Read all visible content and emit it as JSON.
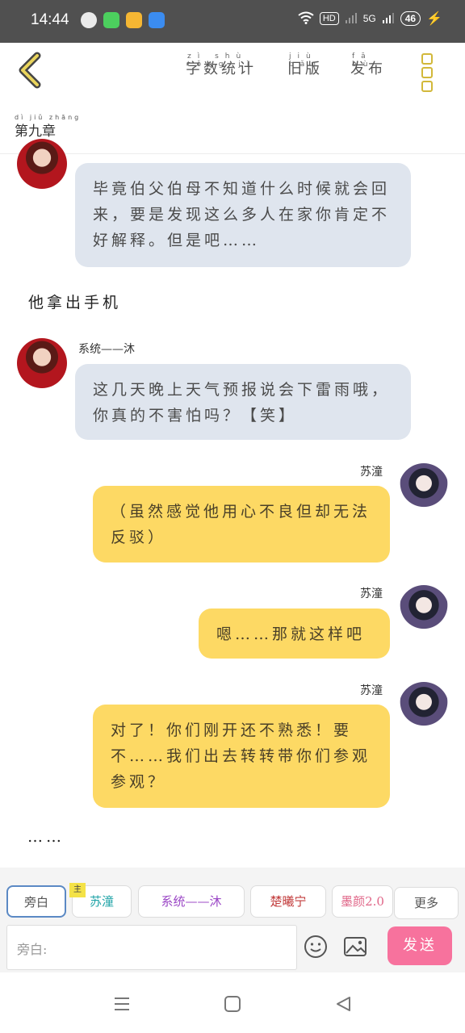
{
  "status_bar": {
    "time": "14:44",
    "hd_label": "HD",
    "network_label": "5G",
    "battery": "46"
  },
  "topbar": {
    "nav": [
      {
        "pinyin": "zì shù tǒng jì",
        "label": "字数统计"
      },
      {
        "pinyin": "jiù bǎn",
        "label": "旧版"
      },
      {
        "pinyin": "fā bù",
        "label": "发布"
      }
    ]
  },
  "chapter": {
    "pinyin": "dì jiǔ zhāng",
    "title": "第九章"
  },
  "messages": {
    "m1": {
      "text": "毕竟伯父伯母不知道什么时候就会回来，要是发现这么多人在家你肯定不好解释。但是吧……"
    },
    "narration1": {
      "text": "他拿出手机"
    },
    "m2": {
      "speaker": "系统——沐",
      "text": "这几天晚上天气预报说会下雷雨哦，你真的不害怕吗？【笑】"
    },
    "m3": {
      "speaker": "苏潼",
      "text": "（虽然感觉他用心不良但却无法反驳）"
    },
    "m4": {
      "speaker": "苏潼",
      "text": "嗯……那就这样吧"
    },
    "m5": {
      "speaker": "苏潼",
      "text": "对了！你们刚开还不熟悉！要不……我们出去转转带你们参观参观？"
    },
    "narration2": {
      "text": "……"
    }
  },
  "role_chips": {
    "narration": "旁白",
    "main_badge": "主",
    "su_tong": "苏潼",
    "system_mu": "系统——沐",
    "chu_xi_ning": "楚曦宁",
    "mo_yan": "墨颜2.0",
    "more": "更多"
  },
  "input": {
    "placeholder": "旁白:"
  },
  "send_button": {
    "label": "发送"
  },
  "colors": {
    "gray_bubble": "#dfe5ee",
    "yellow_bubble": "#fdd964",
    "send_pink": "#f7729d",
    "accent_gold": "#d2b83a"
  }
}
